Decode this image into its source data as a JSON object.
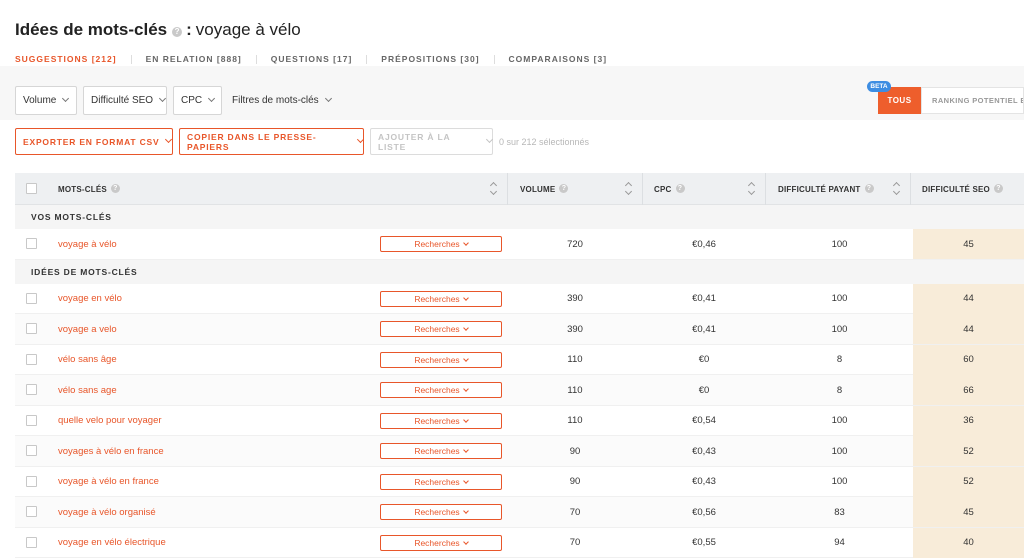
{
  "header": {
    "title": "Idées de mots-clés",
    "colon": ":",
    "subject": "voyage à vélo",
    "help_icon": "question-icon"
  },
  "tabs": [
    {
      "label": "SUGGESTIONS [212]"
    },
    {
      "label": "EN RELATION [888]"
    },
    {
      "label": "QUESTIONS [17]"
    },
    {
      "label": "PRÉPOSITIONS [30]"
    },
    {
      "label": "COMPARAISONS [3]"
    }
  ],
  "filters": {
    "volume": "Volume",
    "seo_difficulty": "Difficulté SEO",
    "cpc": "CPC",
    "keyword_filters": "Filtres de mots-clés"
  },
  "toggle": {
    "beta": "BETA",
    "tous": "TOUS",
    "ranking": "RANKING POTENTIEL EN F"
  },
  "actions": {
    "export_csv": "EXPORTER EN FORMAT CSV",
    "copy_clipboard": "COPIER DANS LE PRESSE-PAPIERS",
    "add_to_list": "AJOUTER À LA LISTE",
    "selected": "0 sur 212 sélectionnés"
  },
  "table": {
    "columns": {
      "keywords": "MOTS-CLÉS",
      "volume": "VOLUME",
      "cpc": "CPC",
      "paid_difficulty": "DIFFICULTÉ PAYANT",
      "seo_difficulty": "DIFFICULTÉ SEO"
    },
    "research_label": "Recherches",
    "sections": [
      {
        "label": "VOS MOTS-CLÉS",
        "rows": [
          {
            "keyword": "voyage à vélo",
            "volume": "720",
            "cpc": "€0,46",
            "paid": "100",
            "seo": "45"
          }
        ]
      },
      {
        "label": "IDÉES DE MOTS-CLÉS",
        "rows": [
          {
            "keyword": "voyage en vélo",
            "volume": "390",
            "cpc": "€0,41",
            "paid": "100",
            "seo": "44"
          },
          {
            "keyword": "voyage a velo",
            "volume": "390",
            "cpc": "€0,41",
            "paid": "100",
            "seo": "44"
          },
          {
            "keyword": "vélo sans âge",
            "volume": "110",
            "cpc": "€0",
            "paid": "8",
            "seo": "60"
          },
          {
            "keyword": "vélo sans age",
            "volume": "110",
            "cpc": "€0",
            "paid": "8",
            "seo": "66"
          },
          {
            "keyword": "quelle velo pour voyager",
            "volume": "110",
            "cpc": "€0,54",
            "paid": "100",
            "seo": "36"
          },
          {
            "keyword": "voyages à vélo en france",
            "volume": "90",
            "cpc": "€0,43",
            "paid": "100",
            "seo": "52"
          },
          {
            "keyword": "voyage à vélo en france",
            "volume": "90",
            "cpc": "€0,43",
            "paid": "100",
            "seo": "52"
          },
          {
            "keyword": "voyage à vélo organisé",
            "volume": "70",
            "cpc": "€0,56",
            "paid": "83",
            "seo": "45"
          },
          {
            "keyword": "voyage en vélo électrique",
            "volume": "70",
            "cpc": "€0,55",
            "paid": "94",
            "seo": "40"
          }
        ]
      }
    ]
  }
}
